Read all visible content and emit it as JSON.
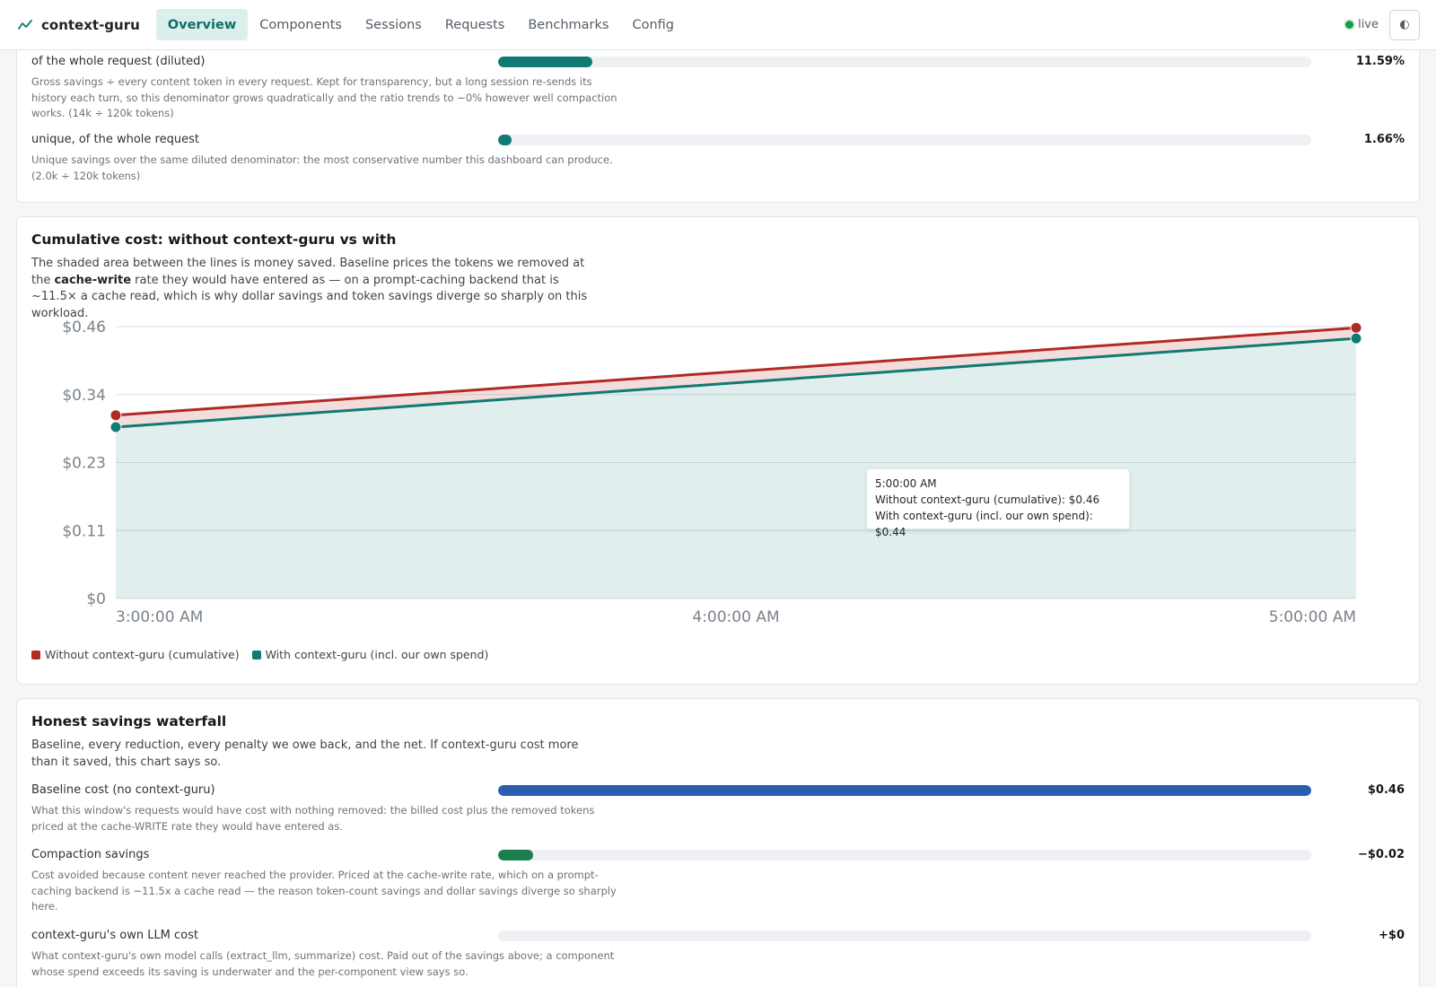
{
  "app": {
    "name": "context-guru"
  },
  "nav": {
    "tabs": [
      {
        "label": "Overview",
        "active": true
      },
      {
        "label": "Components"
      },
      {
        "label": "Sessions"
      },
      {
        "label": "Requests"
      },
      {
        "label": "Benchmarks"
      },
      {
        "label": "Config"
      }
    ],
    "status_label": "live",
    "status_color": "#1a9a4a",
    "theme_icon": "◐"
  },
  "ratios": {
    "rows": [
      {
        "label": "of the whole request (diluted)",
        "value": "11.59%",
        "fraction": 0.1159,
        "color": "#117a73",
        "note": "Gross savings ÷ every content token in every request. Kept for transparency, but a long session re-sends its history each turn, so this denominator grows quadratically and the ratio trends to ~0% however well compaction works. (14k ÷ 120k tokens)"
      },
      {
        "label": "unique, of the whole request",
        "value": "1.66%",
        "fraction": 0.0166,
        "color": "#117a73",
        "note": "Unique savings over the same diluted denominator: the most conservative number this dashboard can produce. (2.0k ÷ 120k tokens)"
      }
    ]
  },
  "cost_chart": {
    "title": "Cumulative cost: without context-guru vs with",
    "desc_pre": "The shaded area between the lines is money saved. Baseline prices the tokens we removed at the ",
    "desc_bold": "cache-write",
    "desc_post": " rate they would have entered as — on a prompt-caching backend that is ~11.5× a cache read, which is why dollar savings and token savings diverge so sharply on this workload.",
    "tooltip": {
      "time": "5:00:00 AM",
      "without": "Without context-guru (cumulative): $0.46",
      "with": "With context-guru (incl. our own spend): $0.44"
    }
  },
  "chart_data": {
    "type": "line",
    "title": "",
    "xlabel": "",
    "ylabel": "",
    "x": [
      "3:00:00 AM",
      "5:00:00 AM"
    ],
    "x_ticks": [
      "3:00:00 AM",
      "4:00:00 AM",
      "5:00:00 AM"
    ],
    "y_ticks": [
      "$0",
      "$0.11",
      "$0.23",
      "$0.34",
      "$0.46"
    ],
    "y_tick_values": [
      0,
      0.115,
      0.23,
      0.345,
      0.46
    ],
    "ylim": [
      0,
      0.46
    ],
    "grid": true,
    "legend": "bottom-left",
    "series": [
      {
        "name": "Without context-guru (cumulative)",
        "color": "#b22a24",
        "values": [
          0.31,
          0.458
        ]
      },
      {
        "name": "With context-guru (incl. our own spend)",
        "color": "#117a73",
        "values": [
          0.29,
          0.44
        ]
      }
    ]
  },
  "waterfall": {
    "title": "Honest savings waterfall",
    "desc": "Baseline, every reduction, every penalty we owe back, and the net. If context-guru cost more than it saved, this chart says so.",
    "rows": [
      {
        "label": "Baseline cost (no context-guru)",
        "value": "$0.46",
        "fraction": 1.0,
        "color": "#2a5faf",
        "note": "What this window's requests would have cost with nothing removed: the billed cost plus the removed tokens priced at the cache-WRITE rate they would have entered as."
      },
      {
        "label": "Compaction savings",
        "value": "−$0.02",
        "fraction": 0.043,
        "color": "#1a7f4e",
        "note": "Cost avoided because content never reached the provider. Priced at the cache-write rate, which on a prompt-caching backend is ~11.5x a cache read — the reason token-count savings and dollar savings diverge so sharply here."
      },
      {
        "label": "context-guru's own LLM cost",
        "value": "+$0",
        "fraction": 0,
        "color": "#b22a24",
        "note": "What context-guru's own model calls (extract_llm, summarize) cost. Paid out of the savings above; a component whose spend exceeds its saving is underwater and the per-component view says so."
      }
    ]
  }
}
